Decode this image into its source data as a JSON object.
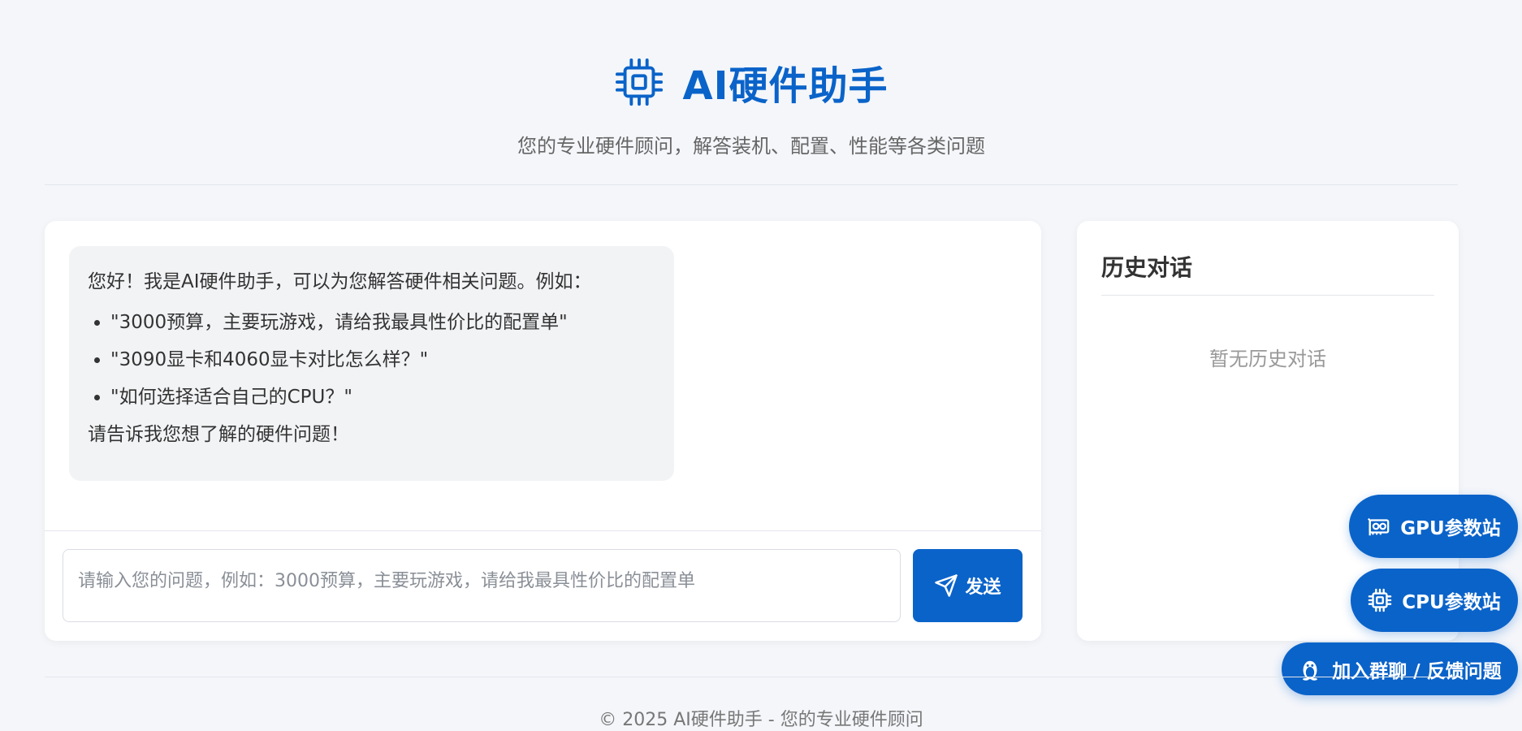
{
  "header": {
    "title": "AI硬件助手",
    "subtitle": "您的专业硬件顾问，解答装机、配置、性能等各类问题",
    "icon": "chip-icon"
  },
  "chat": {
    "greeting": {
      "intro": "您好！我是AI硬件助手，可以为您解答硬件相关问题。例如：",
      "examples": [
        "\"3000预算，主要玩游戏，请给我最具性价比的配置单\"",
        "\"3090显卡和4060显卡对比怎么样？\"",
        "\"如何选择适合自己的CPU？\""
      ],
      "outro": "请告诉我您想了解的硬件问题！"
    },
    "input": {
      "placeholder": "请输入您的问题，例如：3000预算，主要玩游戏，请给我最具性价比的配置单",
      "value": ""
    },
    "send_label": "发送"
  },
  "history": {
    "title": "历史对话",
    "empty_text": "暂无历史对话"
  },
  "floating": {
    "gpu_label": "GPU参数站",
    "cpu_label": "CPU参数站",
    "group_label": "加入群聊 / 反馈问题"
  },
  "footer": {
    "text": "© 2025 AI硬件助手 - 您的专业硬件顾问"
  },
  "colors": {
    "accent": "#0a63c9",
    "background": "#f4f6fa",
    "bubble": "#f2f3f5"
  }
}
